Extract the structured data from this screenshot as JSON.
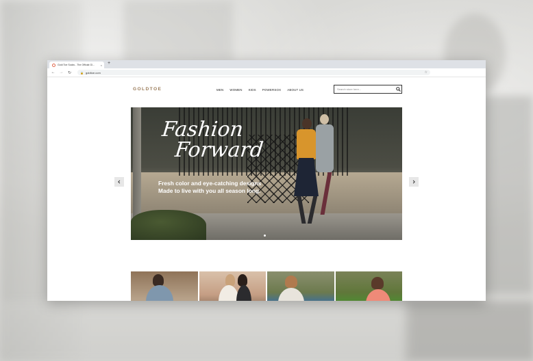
{
  "browser": {
    "tab_title": "Gold Toe Socks - The Official Gl...",
    "tab_close": "×",
    "new_tab": "+",
    "url": "goldtoe.com"
  },
  "site": {
    "logo": "GOLDTOE",
    "menu": [
      "MEN",
      "WOMEN",
      "KIDS",
      "POWERSOX",
      "ABOUT US"
    ],
    "search_placeholder": "Search store here..."
  },
  "hero": {
    "title_line1": "Fashion",
    "title_line2": "Forward",
    "subtitle_line1": "Fresh color and eye-catching designs",
    "subtitle_line2": "Made to live with you all season long."
  },
  "colors": {
    "logo": "#9a7b59",
    "cardigan": "#d8952c",
    "skirt": "#1e2535"
  },
  "icons": [
    "back-icon",
    "forward-icon",
    "reload-icon",
    "lock-icon",
    "star-icon",
    "search-icon",
    "chevron-left-icon",
    "chevron-right-icon"
  ]
}
